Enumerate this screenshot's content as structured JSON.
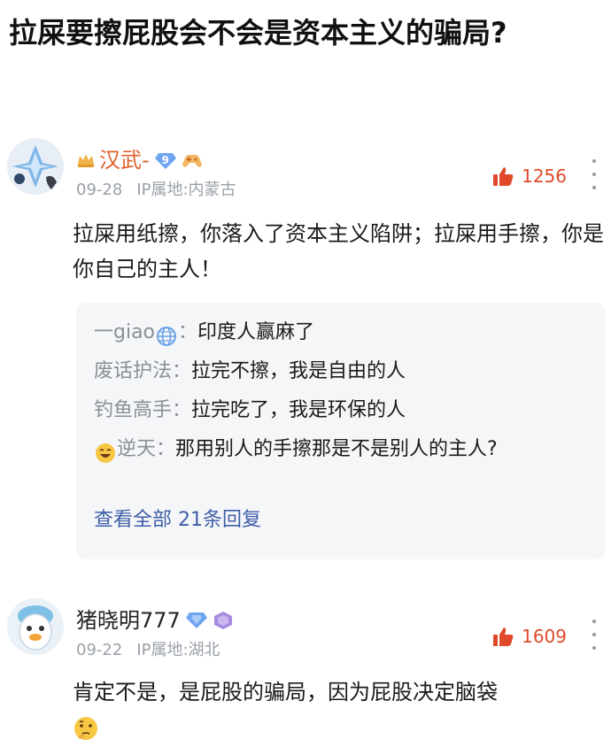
{
  "post": {
    "title": "拉屎要擦屁股会不会是资本主义的骗局?"
  },
  "comments": [
    {
      "username": "汉武-",
      "level": "9",
      "date": "09-28",
      "ip_location": "IP属地:内蒙古",
      "likes": "1256",
      "content": "拉屎用纸擦，你落入了资本主义陷阱；拉屎用手擦，你是你自己的主人！",
      "replies": [
        {
          "name": "一giao",
          "sep": "：",
          "text": "印度人赢麻了"
        },
        {
          "name": "废话护法",
          "sep": "：",
          "text": "拉完不擦，我是自由的人"
        },
        {
          "name": "钓鱼高手",
          "sep": "：",
          "text": "拉完吃了，我是环保的人"
        },
        {
          "name": "逆天",
          "sep": "：",
          "text": "那用别人的手擦那是不是别人的主人?"
        }
      ],
      "view_all": "查看全部 21条回复"
    },
    {
      "username": "猪晓明777",
      "date": "09-22",
      "ip_location": "IP属地:湖北",
      "likes": "1609",
      "content": "肯定不是，是屁股的骗局，因为屁股决定脑袋"
    }
  ],
  "colors": {
    "accent_orange": "#e0612c",
    "like_red": "#e04a2a",
    "link_blue": "#3f5ea8",
    "meta_gray": "#9aa0a8",
    "reply_bg": "#f5f6f8"
  },
  "icons": {
    "crown": "crown-icon",
    "level_badge": "diamond-level-badge",
    "game": "gamepad-icon",
    "thumb": "thumb-up-icon",
    "more": "more-vertical-icon",
    "globe": "globe-icon",
    "laugh": "laughing-emoji-icon",
    "think": "thinking-emoji-icon"
  }
}
